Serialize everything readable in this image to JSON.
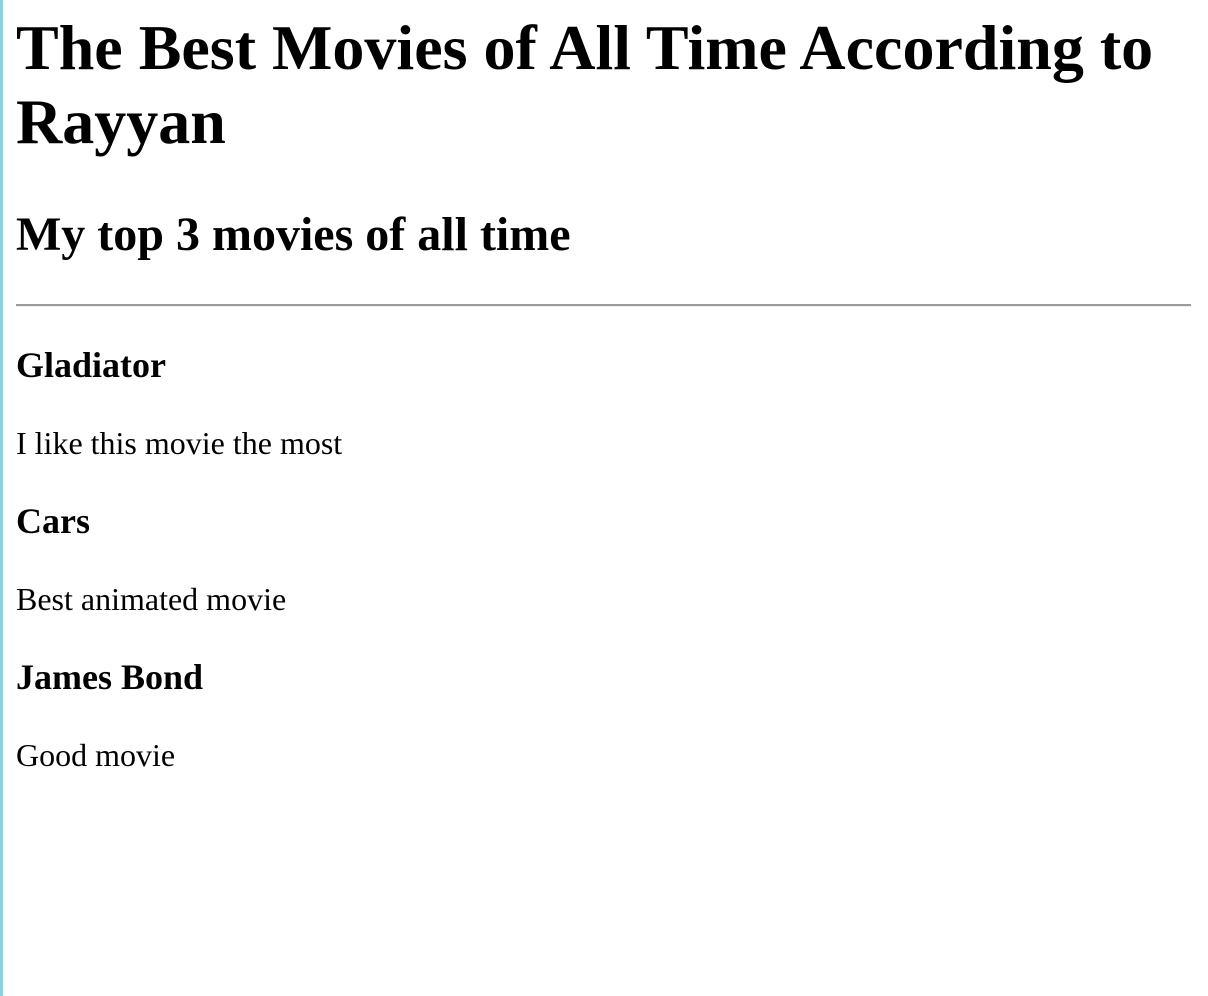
{
  "page": {
    "title": "The Best Movies of All Time According to Rayyan",
    "subtitle": "My top 3 movies of all time"
  },
  "movies": [
    {
      "title": "Gladiator",
      "description": "I like this movie the most"
    },
    {
      "title": "Cars",
      "description": "Best animated movie"
    },
    {
      "title": "James Bond",
      "description": "Good movie"
    }
  ],
  "colors": {
    "text": "#000000",
    "background": "#ffffff",
    "divider": "#9a9a9a",
    "window_edge": "#8fd0e0"
  }
}
